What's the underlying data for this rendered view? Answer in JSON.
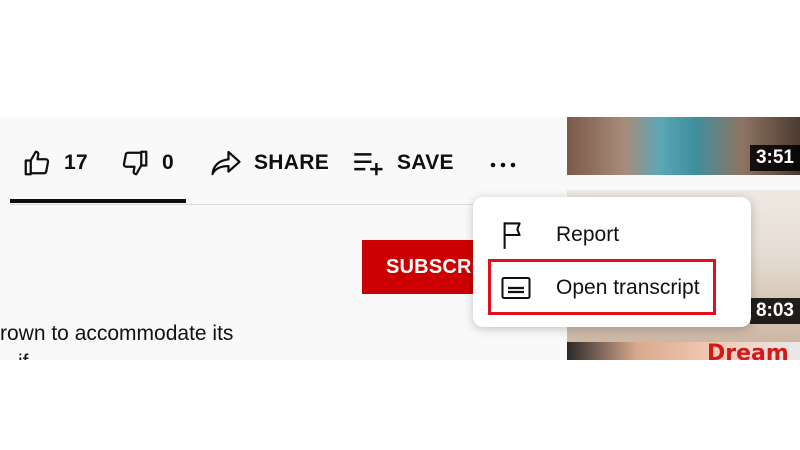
{
  "actions": {
    "like": {
      "count": "17",
      "icon": "thumb-up-icon"
    },
    "dislike": {
      "count": "0",
      "icon": "thumb-down-icon"
    },
    "share": {
      "label": "SHARE",
      "icon": "share-icon"
    },
    "save": {
      "label": "SAVE",
      "icon": "playlist-add-icon"
    },
    "more": {
      "icon": "more-horizontal-icon"
    }
  },
  "subscribe": {
    "label": "SUBSCRIBE"
  },
  "description": {
    "line1": "rown to accommodate its",
    "line2": "if"
  },
  "menu": {
    "items": [
      {
        "label": "Report",
        "icon": "flag-icon"
      },
      {
        "label": "Open transcript",
        "icon": "transcript-icon"
      }
    ]
  },
  "recommended": [
    {
      "duration": "3:51"
    },
    {
      "duration": "8:03"
    },
    {
      "title_overlay": "Dream"
    }
  ],
  "colors": {
    "subscribe_bg": "#cc0000",
    "highlight_border": "#e0101a",
    "text": "#0f0f0f"
  }
}
